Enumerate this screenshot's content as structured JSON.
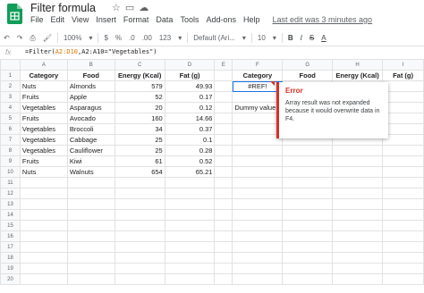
{
  "doc": {
    "title": "Filter formula",
    "menu": [
      "File",
      "Edit",
      "View",
      "Insert",
      "Format",
      "Data",
      "Tools",
      "Add-ons",
      "Help"
    ],
    "last_edit": "Last edit was 3 minutes ago"
  },
  "toolbar": {
    "zoom": "100%",
    "currency": "$",
    "percent": "%",
    "decimals_less": ".0",
    "decimals_more": ".00",
    "number_format": "123",
    "font": "Default (Ari...",
    "font_size": "10",
    "bold": "B",
    "italic": "I",
    "strike": "S",
    "text_color": "A"
  },
  "formula_bar": {
    "fx": "fx",
    "prefix": "=Filter(",
    "ref1": "A2:D10",
    "mid": ",A2:A10=\"Vegetables\")",
    "ref2": ""
  },
  "columns": [
    "A",
    "B",
    "C",
    "D",
    "E",
    "F",
    "G",
    "H",
    "I"
  ],
  "rows": [
    [
      "Category",
      "Food",
      "Energy (Kcal)",
      "Fat (g)",
      "",
      "Category",
      "Food",
      "Energy (Kcal)",
      "Fat (g)"
    ],
    [
      "Nuts",
      "Almonds",
      "579",
      "49.93",
      "",
      "#REF!",
      "",
      "",
      ""
    ],
    [
      "Fruits",
      "Apple",
      "52",
      "0.17",
      "",
      "",
      "",
      "",
      ""
    ],
    [
      "Vegetables",
      "Asparagus",
      "20",
      "0.12",
      "",
      "Dummy value",
      "",
      "",
      ""
    ],
    [
      "Fruits",
      "Avocado",
      "160",
      "14.66",
      "",
      "",
      "",
      "",
      ""
    ],
    [
      "Vegetables",
      "Broccoli",
      "34",
      "0.37",
      "",
      "",
      "",
      "",
      ""
    ],
    [
      "Vegetables",
      "Cabbage",
      "25",
      "0.1",
      "",
      "",
      "",
      "",
      ""
    ],
    [
      "Vegetables",
      "Cauliflower",
      "25",
      "0.28",
      "",
      "",
      "",
      "",
      ""
    ],
    [
      "Fruits",
      "Kiwi",
      "61",
      "0.52",
      "",
      "",
      "",
      "",
      ""
    ],
    [
      "Nuts",
      "Walnuts",
      "654",
      "65.21",
      "",
      "",
      "",
      "",
      ""
    ],
    [
      "",
      "",
      "",
      "",
      "",
      "",
      "",
      "",
      ""
    ],
    [
      "",
      "",
      "",
      "",
      "",
      "",
      "",
      "",
      ""
    ],
    [
      "",
      "",
      "",
      "",
      "",
      "",
      "",
      "",
      ""
    ],
    [
      "",
      "",
      "",
      "",
      "",
      "",
      "",
      "",
      ""
    ],
    [
      "",
      "",
      "",
      "",
      "",
      "",
      "",
      "",
      ""
    ],
    [
      "",
      "",
      "",
      "",
      "",
      "",
      "",
      "",
      ""
    ],
    [
      "",
      "",
      "",
      "",
      "",
      "",
      "",
      "",
      ""
    ],
    [
      "",
      "",
      "",
      "",
      "",
      "",
      "",
      "",
      ""
    ],
    [
      "",
      "",
      "",
      "",
      "",
      "",
      "",
      "",
      ""
    ],
    [
      "",
      "",
      "",
      "",
      "",
      "",
      "",
      "",
      ""
    ]
  ],
  "error_popup": {
    "title": "Error",
    "message": "Array result was not expanded because it would overwrite data in F4."
  }
}
